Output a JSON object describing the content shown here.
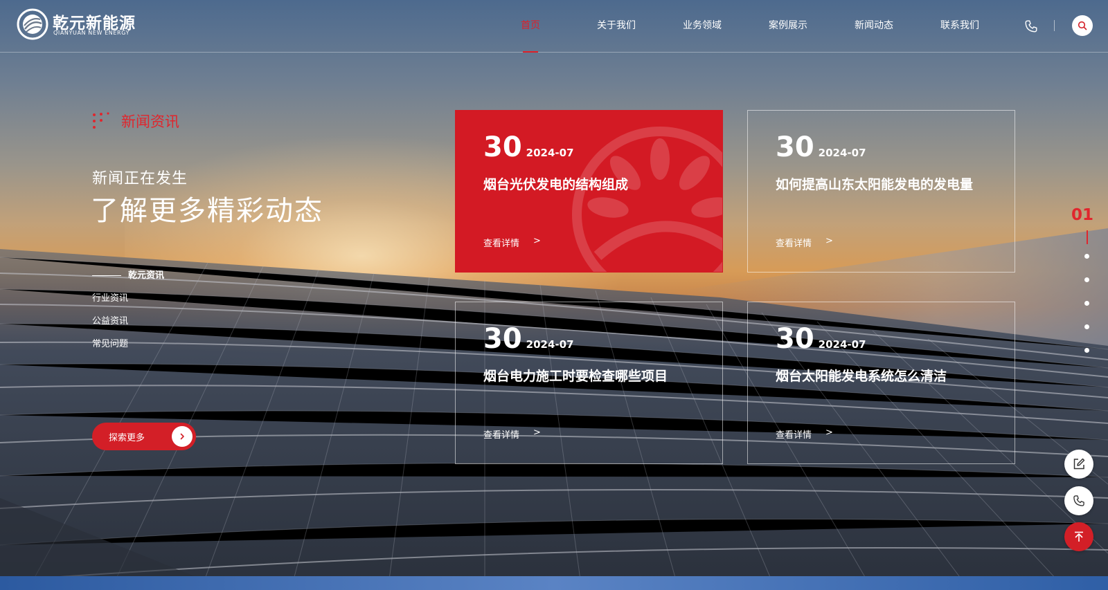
{
  "brand": {
    "name_cn": "乾元新能源",
    "name_en": "QIANYUAN NEW ENERGY",
    "accent": "#d31f27"
  },
  "nav": {
    "items": [
      {
        "label": "首页",
        "active": true
      },
      {
        "label": "关于我们",
        "active": false
      },
      {
        "label": "业务领域",
        "active": false
      },
      {
        "label": "案例展示",
        "active": false
      },
      {
        "label": "新闻动态",
        "active": false
      },
      {
        "label": "联系我们",
        "active": false
      }
    ],
    "phone_icon": "phone-icon",
    "search_icon": "search-icon"
  },
  "section": {
    "label": "新闻资讯",
    "subheading": "新闻正在发生",
    "heading": "了解更多精彩动态",
    "categories": [
      {
        "label": "乾元资讯",
        "active": true
      },
      {
        "label": "行业资讯",
        "active": false
      },
      {
        "label": "公益资讯",
        "active": false
      },
      {
        "label": "常见问题",
        "active": false
      }
    ],
    "explore_label": "探索更多"
  },
  "news": [
    {
      "day": "30",
      "year_month": "2024-07",
      "title": "烟台光伏发电的结构组成",
      "link_label": "查看详情",
      "arrow": ">",
      "featured": true
    },
    {
      "day": "30",
      "year_month": "2024-07",
      "title": "如何提高山东太阳能发电的发电量",
      "link_label": "查看详情",
      "arrow": ">",
      "featured": false
    },
    {
      "day": "30",
      "year_month": "2024-07",
      "title": "烟台电力施工时要检查哪些项目",
      "link_label": "查看详情",
      "arrow": ">",
      "featured": false
    },
    {
      "day": "30",
      "year_month": "2024-07",
      "title": "烟台太阳能发电系统怎么清洁",
      "link_label": "查看详情",
      "arrow": ">",
      "featured": false
    }
  ],
  "pager": {
    "current": "01",
    "dot_count": 5
  },
  "floating": {
    "items": [
      "edit-icon",
      "phone-icon",
      "back-to-top-icon"
    ]
  }
}
